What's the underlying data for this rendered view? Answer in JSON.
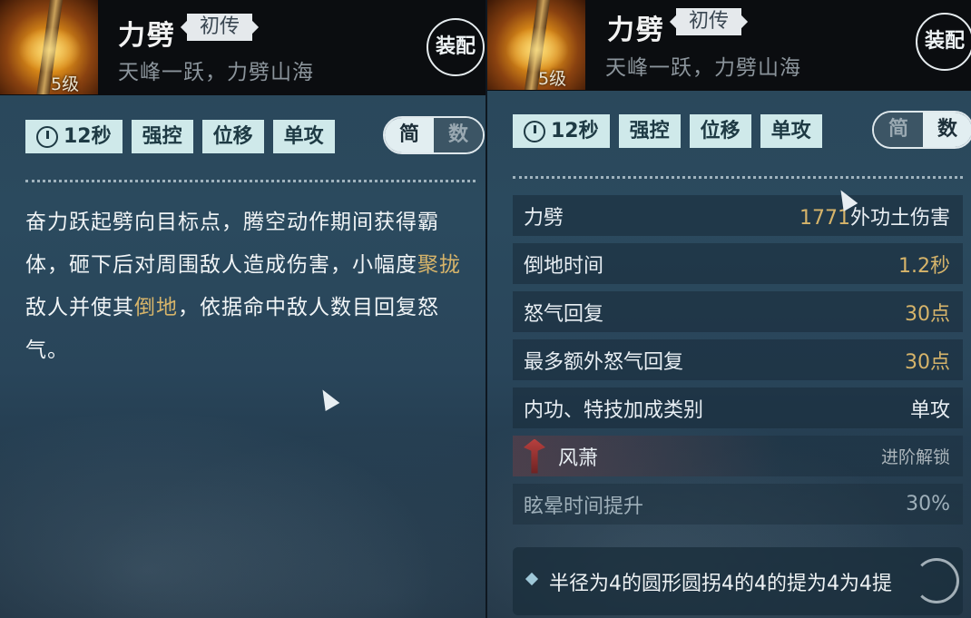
{
  "left": {
    "skill_name": "力劈",
    "rank_badge": "初传",
    "subtitle": "天峰一跃，力劈山海",
    "level": "5级",
    "equip_label": "装配",
    "tags": {
      "cooldown": "12秒",
      "tag1": "强控",
      "tag2": "位移",
      "tag3": "单攻"
    },
    "toggle": {
      "simple": "简",
      "numbers": "数"
    },
    "description": {
      "part1": "奋力跃起劈向目标点，腾空动作期间获得霸体，砸下后对周围敌人造成伤害，小幅度",
      "highlight1": "聚拢",
      "part2": "敌人并使其",
      "highlight2": "倒地",
      "part3": "，依据命中敌人数目回复怒气。"
    }
  },
  "right": {
    "skill_name": "力劈",
    "rank_badge": "初传",
    "subtitle": "天峰一跃，力劈山海",
    "level": "5级",
    "equip_label": "装配",
    "tags": {
      "cooldown": "12秒",
      "tag1": "强控",
      "tag2": "位移",
      "tag3": "单攻"
    },
    "toggle": {
      "simple": "简",
      "numbers": "数"
    },
    "stats": [
      {
        "key": "力劈",
        "value_num": "1771",
        "value_text": "外功土伤害"
      },
      {
        "key": "倒地时间",
        "value": "1.2秒"
      },
      {
        "key": "怒气回复",
        "value": "30点"
      },
      {
        "key": "最多额外怒气回复",
        "value": "30点"
      },
      {
        "key": "内功、特技加成类别",
        "value": "单攻"
      }
    ],
    "school": {
      "name": "风萧",
      "unlock": "进阶解锁"
    },
    "school_stat": {
      "key": "眩晕时间提升",
      "value": "30%"
    },
    "bottom_text": "半径为4的圆形圆拐4的4的提为4为4提"
  },
  "colors": {
    "accent_gold": "#d6b46a",
    "tag_bg": "#cfe9ea"
  }
}
